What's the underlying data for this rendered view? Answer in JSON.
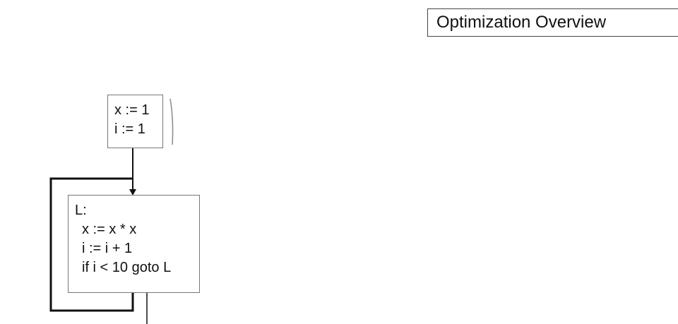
{
  "slide": {
    "title": "Optimization Overview",
    "entry_block": {
      "lines": [
        "x := 1",
        "i := 1"
      ]
    },
    "loop_block": {
      "label": "L:",
      "lines": [
        "x := x * x",
        "i := i + 1",
        "if i < 10 goto L"
      ]
    }
  }
}
